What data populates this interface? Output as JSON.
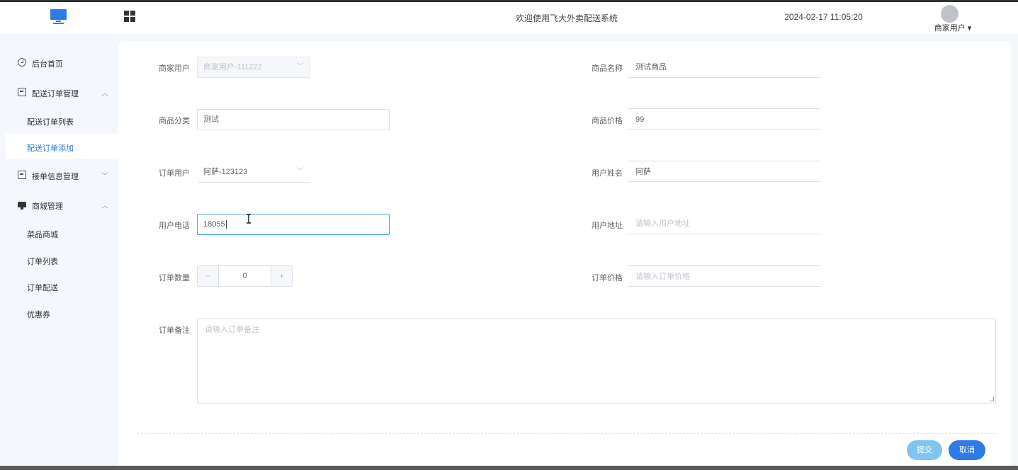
{
  "header": {
    "welcome_text": "欢迎使用飞大外卖配送系统",
    "datetime": "2024-02-17 11:05:20",
    "user_name": "商家用户 ▾"
  },
  "sidebar": {
    "items": [
      {
        "label": "后台首页",
        "icon": "clock-icon"
      },
      {
        "label": "配送订单管理",
        "icon": "box-icon",
        "arrow": "︿"
      },
      {
        "label": "配送订单列表"
      },
      {
        "label": "配送订单添加",
        "active": true
      },
      {
        "label": "接单信息管理",
        "icon": "box-icon",
        "arrow": "﹀"
      },
      {
        "label": "商城管理",
        "icon": "shop-icon",
        "arrow": "︿"
      },
      {
        "label": "菜品商城"
      },
      {
        "label": "订单列表"
      },
      {
        "label": "订单配送"
      },
      {
        "label": "优惠券"
      }
    ]
  },
  "form": {
    "merchant_user": {
      "label": "商家用户",
      "value": "商家用户-111222"
    },
    "product_name": {
      "label": "商品名称",
      "value": "测试商品"
    },
    "product_category": {
      "label": "商品分类",
      "value": "测试"
    },
    "product_price": {
      "label": "商品价格",
      "value": "99"
    },
    "order_user": {
      "label": "订单用户",
      "value": "阿萨-123123"
    },
    "user_name": {
      "label": "用户姓名",
      "value": "阿萨"
    },
    "user_phone": {
      "label": "用户电话",
      "value": "18055"
    },
    "user_address": {
      "label": "用户地址",
      "placeholder": "请输入用户地址"
    },
    "order_quantity": {
      "label": "订单数量",
      "value": "0",
      "minus": "−",
      "plus": "+"
    },
    "order_price": {
      "label": "订单价格",
      "placeholder": "请输入订单价格"
    },
    "order_remark": {
      "label": "订单备注",
      "placeholder": "请输入订单备注"
    }
  },
  "actions": {
    "submit_label": "提交",
    "cancel_label": "取消"
  },
  "colors": {
    "accent": "#2f7ae5",
    "submit_button": "#80c5f0",
    "focus_border": "#409eff"
  }
}
